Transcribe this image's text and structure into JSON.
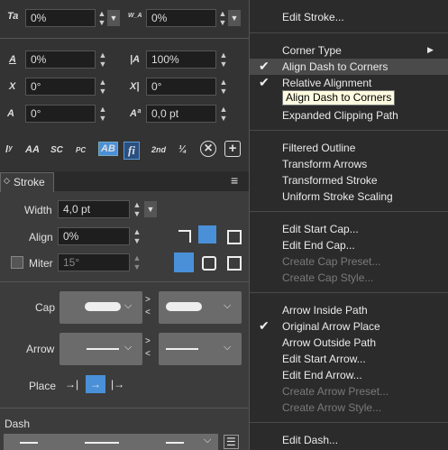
{
  "top_fields": {
    "char_left": "0%",
    "char_right": "0%",
    "baseline_left": "0%",
    "baseline_right": "100%",
    "skew_left": "0°",
    "skew_right": "0°",
    "rotate_left": "0°",
    "kern_right": "0,0 pt"
  },
  "typo_buttons": [
    "AA",
    "SC",
    "PC",
    "AB",
    "fi",
    "2nd",
    "¼"
  ],
  "stroke_panel": {
    "tab": "Stroke",
    "width_label": "Width",
    "width_value": "4,0 pt",
    "align_label": "Align",
    "align_value": "0%",
    "miter_label": "Miter",
    "miter_value": "15°",
    "cap_label": "Cap",
    "arrow_label": "Arrow",
    "place_label": "Place",
    "dash_label": "Dash"
  },
  "menu": {
    "items": [
      {
        "label": "Edit Stroke...",
        "disabled": false
      },
      {
        "label": "Corner Type",
        "disabled": false
      },
      {
        "label": "Align Dash to Corners",
        "disabled": false
      },
      {
        "label": "Relative Alignment",
        "disabled": false
      },
      {
        "label": "Expanded Clipping Path",
        "disabled": false
      },
      {
        "label": "Filtered Outline",
        "disabled": false
      },
      {
        "label": "Transform Arrows",
        "disabled": false
      },
      {
        "label": "Transformed Stroke",
        "disabled": false
      },
      {
        "label": "Uniform Stroke Scaling",
        "disabled": false
      },
      {
        "label": "Edit Start Cap...",
        "disabled": false
      },
      {
        "label": "Edit End Cap...",
        "disabled": false
      },
      {
        "label": "Create Cap Preset...",
        "disabled": true
      },
      {
        "label": "Create Cap Style...",
        "disabled": true
      },
      {
        "label": "Arrow Inside Path",
        "disabled": false
      },
      {
        "label": "Original Arrow Place",
        "disabled": false
      },
      {
        "label": "Arrow Outside Path",
        "disabled": false
      },
      {
        "label": "Edit Start Arrow...",
        "disabled": false
      },
      {
        "label": "Edit End Arrow...",
        "disabled": false
      },
      {
        "label": "Create Arrow Preset...",
        "disabled": true
      },
      {
        "label": "Create Arrow Style...",
        "disabled": true
      },
      {
        "label": "Edit Dash...",
        "disabled": false
      }
    ],
    "tooltip": "Align Dash to Corners"
  }
}
